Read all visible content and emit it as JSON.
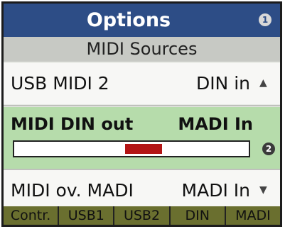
{
  "header": {
    "title": "Options",
    "badge": "1"
  },
  "subheader": "MIDI Sources",
  "rows": [
    {
      "label": "USB MIDI 2",
      "value": "DIN in",
      "arrow": "▲"
    },
    {
      "label": "MIDI DIN out",
      "value": "MADI In",
      "meter_level": 0.55,
      "badge": "2"
    },
    {
      "label": "MIDI ov. MADI",
      "value": "MADI In",
      "arrow": "▼"
    }
  ],
  "tabs": [
    "Contr.",
    "USB1",
    "USB2",
    "DIN",
    "MADI"
  ],
  "colors": {
    "header": "#2d4d86",
    "selected_row": "#b6dcab",
    "meter_fill": "#b31515",
    "tab_bar": "#6a6f2f"
  }
}
